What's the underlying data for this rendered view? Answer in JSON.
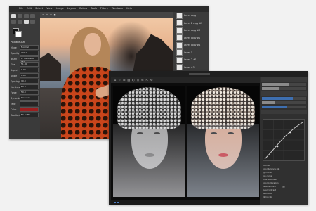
{
  "back_window": {
    "menu": [
      "File",
      "Edit",
      "Select",
      "View",
      "Image",
      "Layers",
      "Colors",
      "Tools",
      "Filters",
      "Windows",
      "Help"
    ],
    "tabs": [
      "≡",
      "×",
      "⧉",
      "◧"
    ],
    "tool_options": {
      "header": "Paintbrush",
      "rows": [
        {
          "label": "Mode",
          "value": "Normal"
        },
        {
          "label": "Opacity",
          "value": "100.0"
        },
        {
          "label": "Brush",
          "value": "2. Hardness 050"
        },
        {
          "label": "Size",
          "value": "51.00"
        },
        {
          "label": "Aspect",
          "value": "0.00"
        },
        {
          "label": "Angle",
          "value": "0.00"
        },
        {
          "label": "Spacing",
          "value": "10.0"
        },
        {
          "label": "Hardness",
          "value": "50.0"
        },
        {
          "label": "Force",
          "value": "50.0"
        },
        {
          "label": "Dynamics",
          "value": "Pressure Opacity"
        },
        {
          "label": "Fade",
          "value": ""
        },
        {
          "label": "Color",
          "value": ""
        },
        {
          "label": "Gradient",
          "value": "FG to BG"
        }
      ]
    },
    "layers": [
      "Layer copy",
      "Layer 2 copy #2",
      "Layer copy #3",
      "Layer copy #1",
      "Layer copy #4",
      "Layer 1",
      "Layer 2 #1",
      "Layer #3",
      "Layer copy #5",
      "Background"
    ]
  },
  "front_window": {
    "toolbar": [
      "⌂",
      "☆",
      "⊞",
      "▤",
      "◐",
      "◎",
      "⇋",
      "⇱",
      "⚙"
    ],
    "right_panel_list": [
      "colorize",
      "color balance rgb",
      "rgb levels",
      "rgb curve",
      "tone equalizer",
      "color calibration",
      "haze removal",
      "local contrast",
      "exposure",
      "filmic rgb"
    ],
    "presets_symbol": "≋"
  },
  "colors": {
    "accent_blue": "#3e6fb0",
    "red_field": "#9b1f1f",
    "lips_color": "#c6161e"
  }
}
